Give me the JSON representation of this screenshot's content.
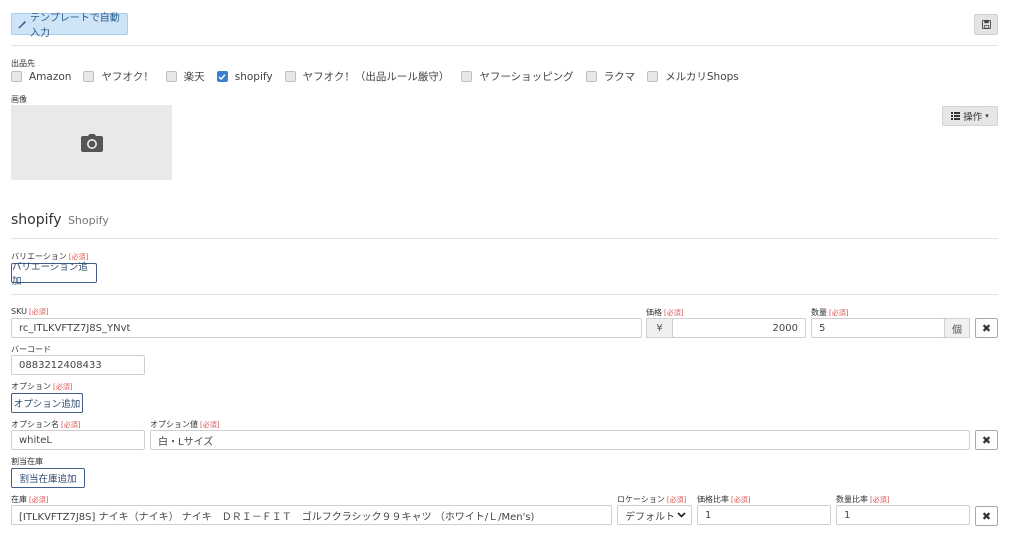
{
  "toolbar": {
    "template_button": "テンプレートで自動入力"
  },
  "channels": {
    "label": "出品先",
    "items": [
      {
        "label": "Amazon",
        "checked": false
      },
      {
        "label": "ヤフオク！",
        "checked": false
      },
      {
        "label": "楽天",
        "checked": false
      },
      {
        "label": "shopify",
        "checked": true
      },
      {
        "label": "ヤフオク！（出品ルール厳守）",
        "checked": false
      },
      {
        "label": "ヤフーショッピング",
        "checked": false
      },
      {
        "label": "ラクマ",
        "checked": false
      },
      {
        "label": "メルカリShops",
        "checked": false
      }
    ]
  },
  "image": {
    "label": "画像",
    "operations_button": "操作"
  },
  "section": {
    "title": "shopify",
    "subtitle": "Shopify"
  },
  "required_tag": "[必須]",
  "variation": {
    "label": "バリエーション",
    "add_button": "バリエーション追加"
  },
  "sku": {
    "label": "SKU",
    "value": "rc_ITLKVFTZ7J8S_YNvt"
  },
  "price": {
    "label": "価格",
    "currency": "¥",
    "value": "2000"
  },
  "quantity": {
    "label": "数量",
    "value": "5",
    "unit": "個"
  },
  "barcode": {
    "label": "バーコード",
    "value": "0883212408433"
  },
  "option": {
    "label": "オプション",
    "add_button": "オプション追加",
    "name_label": "オプション名",
    "name_value": "whiteL",
    "value_label": "オプション値",
    "value_value": "白・Lサイズ"
  },
  "allocation": {
    "label": "割当在庫",
    "add_button": "割当在庫追加"
  },
  "stock": {
    "label": "在庫",
    "value": "[ITLKVFTZ7J8S] ナイキ（ナイキ） ナイキ　ＤＲＩ－ＦＩＴ　ゴルフクラシック９９キャツ （ホワイト/Ｌ/Men's)",
    "location_label": "ロケーション",
    "location_value": "デフォルト",
    "price_ratio_label": "価格比率",
    "price_ratio_value": "1",
    "qty_ratio_label": "数量比率",
    "qty_ratio_value": "1"
  },
  "colors": {
    "accent": "#3d7fd0",
    "required": "#d9534f",
    "template_button_bg": "#cfe4f7"
  }
}
